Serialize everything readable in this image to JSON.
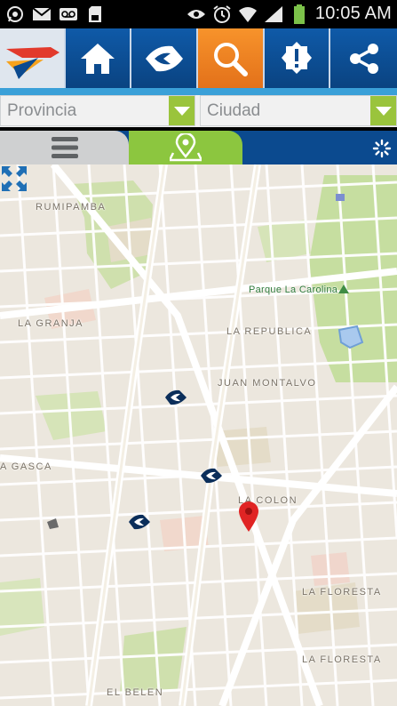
{
  "status_bar": {
    "time": "10:05 AM",
    "left_icons": [
      "whatsapp-icon",
      "gmail-icon",
      "voicemail-icon",
      "sd-card-icon"
    ],
    "right_icons": [
      "eye-icon",
      "alarm-icon",
      "wifi-icon",
      "signal-icon",
      "battery-icon"
    ]
  },
  "toolbar": {
    "items": [
      "logo",
      "home-icon",
      "bank-logo-icon",
      "search-icon",
      "alert-icon",
      "share-icon"
    ],
    "active": "search-icon",
    "colors": {
      "bar": "#0b4a8f",
      "active": "#f08a24"
    }
  },
  "filters": {
    "provincia": {
      "placeholder": "Provincia"
    },
    "ciudad": {
      "placeholder": "Ciudad"
    },
    "accent": "#9ac43c"
  },
  "view_tabs": {
    "list_icon": "list-icon",
    "map_icon": "map-pin-icon",
    "active": "map",
    "refresh_icon": "spinner-icon"
  },
  "map": {
    "labels": {
      "rumipamba": "RUMIPAMBA",
      "parque": "Parque La Carolina",
      "la_granja": "LA GRANJA",
      "la_republica": "LA REPUBLICA",
      "juan_montalvo": "JUAN MONTALVO",
      "la_gasca": "A GASCA",
      "la_colon": "LA COLON",
      "la_floresta_1": "LA FLORESTA",
      "la_floresta_2": "LA FLORESTA",
      "el_belen": "EL BELEN"
    },
    "fullscreen_icon": "fullscreen-icon",
    "markers": [
      "bank-branch-marker",
      "bank-branch-marker",
      "bank-branch-marker"
    ],
    "user_pin": "location-pin-icon"
  }
}
